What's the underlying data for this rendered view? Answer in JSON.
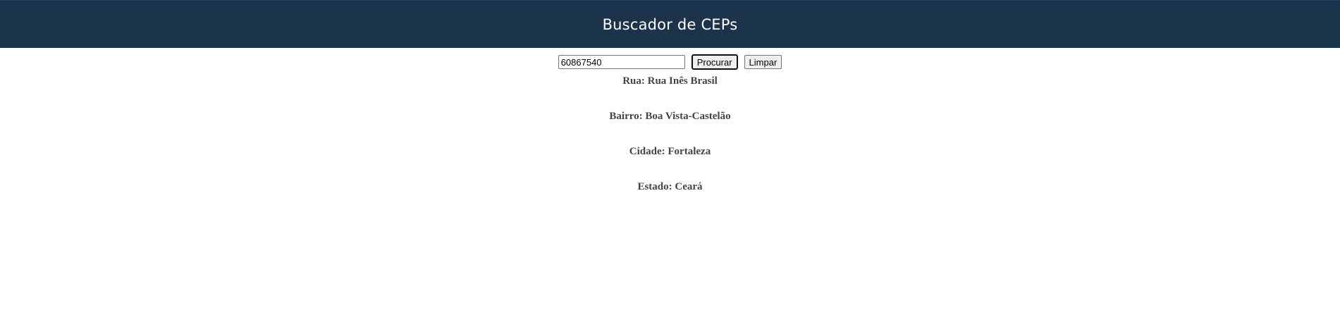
{
  "header": {
    "title": "Buscador de CEPs"
  },
  "search": {
    "value": "60867540",
    "search_button": "Procurar",
    "clear_button": "Limpar"
  },
  "results": {
    "street_label": "Rua:",
    "street_value": "Rua Inês Brasil",
    "neighborhood_label": "Bairro:",
    "neighborhood_value": "Boa Vista-Castelão",
    "city_label": "Cidade:",
    "city_value": "Fortaleza",
    "state_label": "Estado:",
    "state_value": "Ceará"
  },
  "colors": {
    "header_bg": "#1b334b",
    "result_text": "#444444"
  }
}
